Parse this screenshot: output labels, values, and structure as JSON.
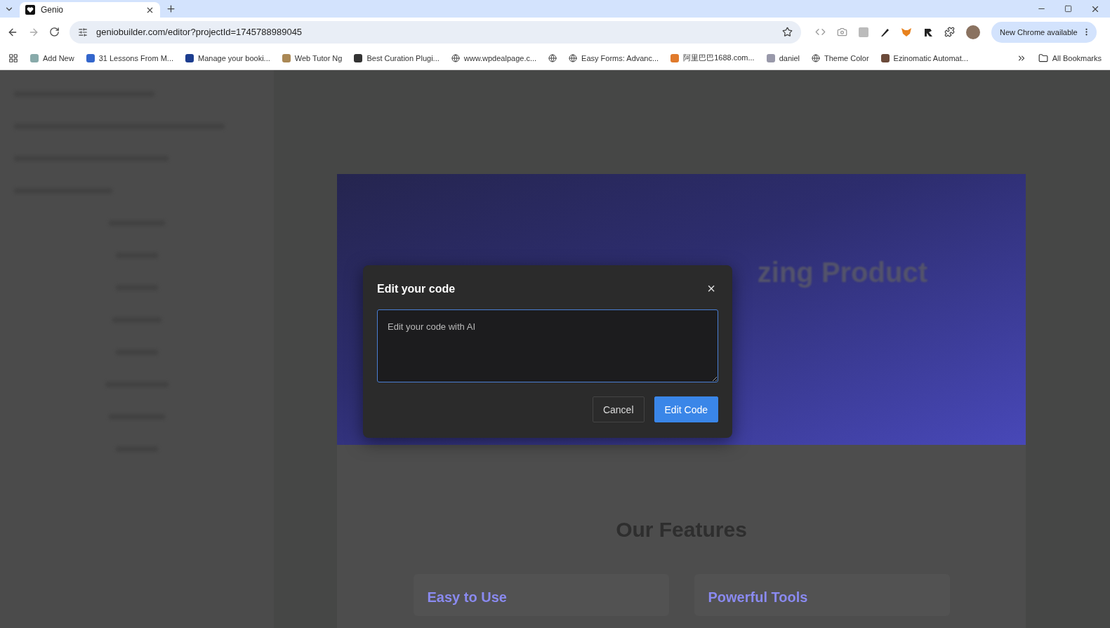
{
  "browser": {
    "tab": {
      "title": "Genio",
      "selected": true
    },
    "url": "geniobuilder.com/editor?projectId=1745788989045",
    "new_chrome": "New Chrome available",
    "bookmarks": [
      {
        "label": "Add New"
      },
      {
        "label": "31 Lessons From M..."
      },
      {
        "label": "Manage your booki..."
      },
      {
        "label": "Web Tutor Ng"
      },
      {
        "label": "Best Curation Plugi..."
      },
      {
        "label": "www.wpdealpage.c..."
      },
      {
        "kind": "icon"
      },
      {
        "label": "Easy Forms: Advanc..."
      },
      {
        "label": "阿里巴巴1688.com..."
      },
      {
        "label": "daniel"
      },
      {
        "label": "Theme Color"
      },
      {
        "label": "Ezinomatic Automat..."
      }
    ],
    "all_bookmarks": "All Bookmarks"
  },
  "preview": {
    "hero_title": "zing Product",
    "section_title": "Our Features",
    "cards": [
      "Easy to Use",
      "Powerful Tools"
    ]
  },
  "dialog": {
    "title": "Edit your code",
    "close": "×",
    "placeholder": "Edit your code with AI",
    "buttons": [
      {
        "label": "Cancel",
        "kind": "secondary"
      },
      {
        "label": "Edit Code",
        "kind": "primary"
      }
    ]
  }
}
